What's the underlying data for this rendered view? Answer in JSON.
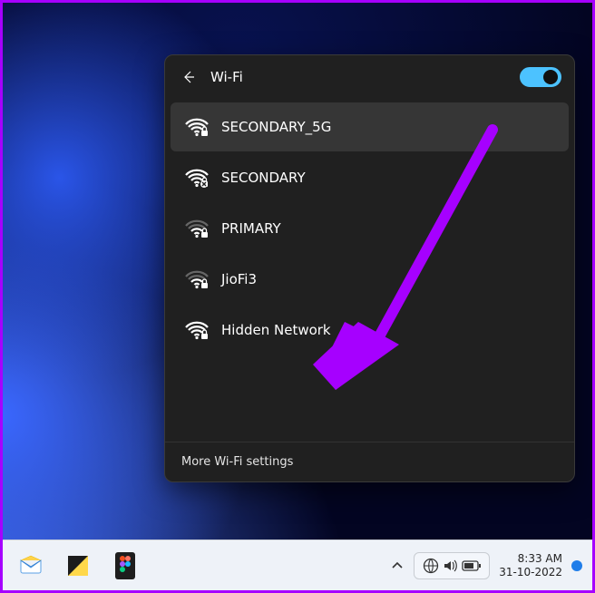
{
  "header": {
    "title": "Wi-Fi",
    "toggle_on": true
  },
  "networks": [
    {
      "ssid": "SECONDARY_5G",
      "signal": 4,
      "secured": true,
      "selected": true
    },
    {
      "ssid": "SECONDARY",
      "signal": 4,
      "secured": true,
      "selected": false,
      "badge": "error"
    },
    {
      "ssid": "PRIMARY",
      "signal": 2,
      "secured": true,
      "selected": false
    },
    {
      "ssid": "JioFi3",
      "signal": 2,
      "secured": true,
      "selected": false
    },
    {
      "ssid": "Hidden Network",
      "signal": 4,
      "secured": true,
      "selected": false
    }
  ],
  "footer": {
    "more_settings": "More Wi-Fi settings"
  },
  "taskbar": {
    "time": "8:33 AM",
    "date": "31-10-2022"
  },
  "colors": {
    "accent": "#4cc2ff",
    "annotation": "#a600ff",
    "panel": "#202020"
  }
}
